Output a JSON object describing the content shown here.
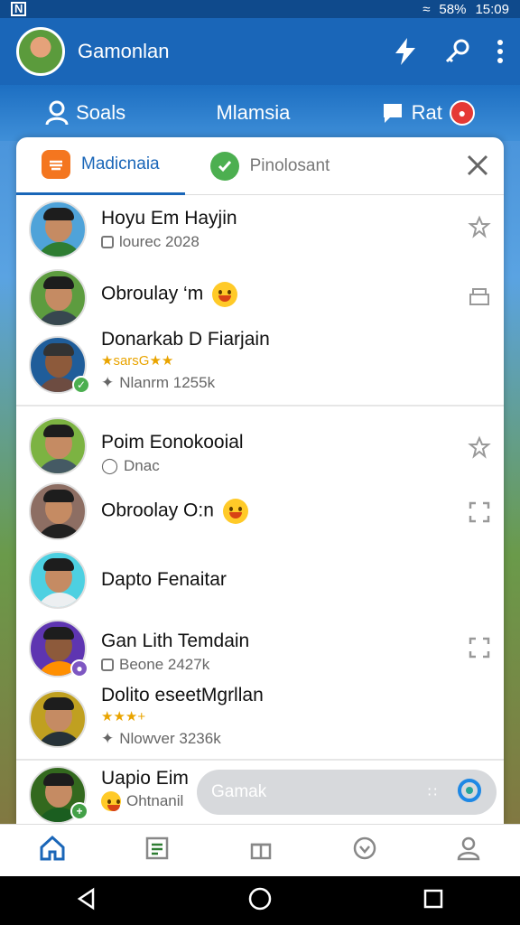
{
  "status_bar": {
    "battery": "58%",
    "time": "15:09"
  },
  "app_bar": {
    "title": "Gamonlan"
  },
  "top_tabs": [
    {
      "label": "Soals"
    },
    {
      "label": "Mlamsia"
    },
    {
      "label": "Rat"
    }
  ],
  "sheet": {
    "tabs": [
      {
        "label": "Madicnaia",
        "active": true
      },
      {
        "label": "Pinolosant",
        "active": false
      }
    ],
    "rows": [
      {
        "name": "Hoyu Em Hayjin",
        "sub": "lourec 2028"
      },
      {
        "name": "Obroulay ‘m",
        "sub": ""
      },
      {
        "name": "Donarkab D Fiarjain",
        "stars": "★sarsG★★",
        "sub": "Nlanrm 1255k"
      },
      {
        "name": "Poim Eonokooial",
        "sub": "Dnac"
      },
      {
        "name": "Obroolay O:n",
        "sub": ""
      },
      {
        "name": "Dapto Fenaitar",
        "sub": ""
      },
      {
        "name": "Gan Lith Temdain",
        "sub": "Beone 2427k"
      },
      {
        "name": "Dolito eseetMgrllan",
        "stars": "★★★+",
        "sub": "Nlowver 3236k"
      },
      {
        "name": "Uapio Eim",
        "sub": "Ohtnanil"
      }
    ]
  },
  "search": {
    "placeholder": "Gamak"
  },
  "colors": {
    "primary": "#1a66b8",
    "accent_orange": "#f4761f",
    "accent_green": "#4caf50"
  }
}
